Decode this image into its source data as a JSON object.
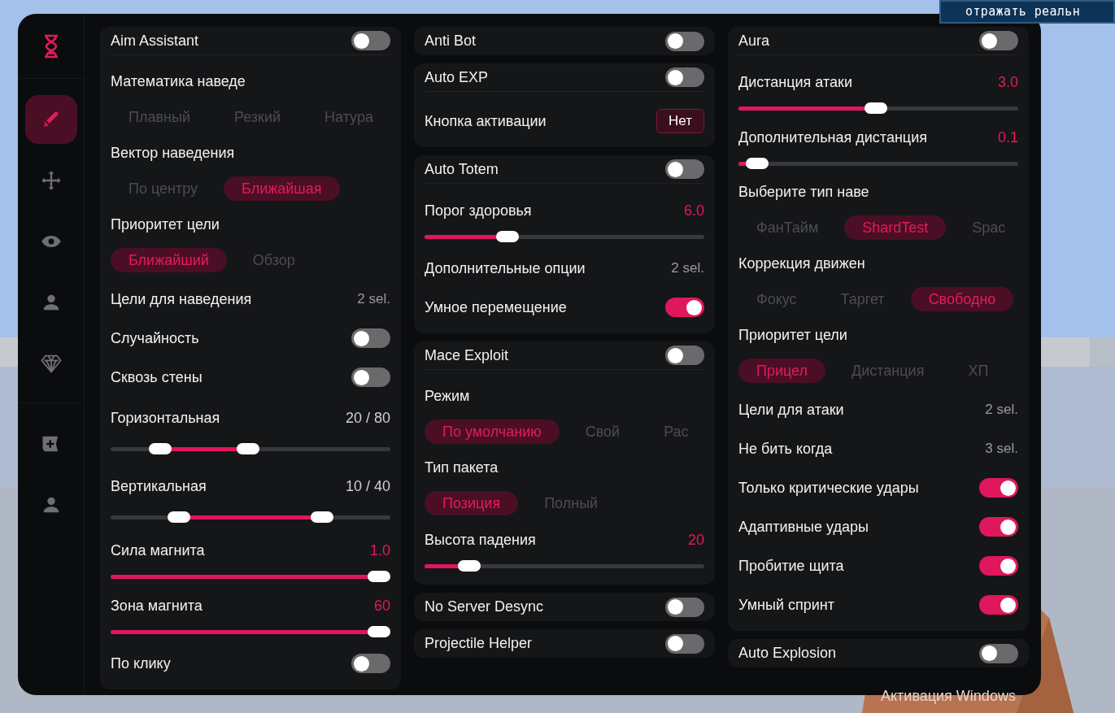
{
  "game_chat": {
    "text": "отражать реальн"
  },
  "os_notice": {
    "text": "Активация Windows"
  },
  "sidebar": {
    "sections": [
      {
        "items": [
          {
            "selected": true
          },
          {
            "selected": false
          },
          {
            "selected": false
          },
          {
            "selected": false
          },
          {
            "selected": false
          }
        ]
      },
      {
        "items": [
          {
            "selected": false
          },
          {
            "selected": false
          }
        ]
      }
    ]
  },
  "columns": [
    [
      {
        "name": "Aim Assistant",
        "enabled": false,
        "settings": [
          {
            "kind": "chips",
            "label": "Математика наведе",
            "options": [
              {
                "label": "Плавный",
                "selected": false
              },
              {
                "label": "Резкий",
                "selected": false
              },
              {
                "label": "Натура",
                "selected": false
              }
            ]
          },
          {
            "kind": "chips",
            "label": "Вектор наведения",
            "options": [
              {
                "label": "По центру",
                "selected": false
              },
              {
                "label": "Ближайшая",
                "selected": true
              }
            ]
          },
          {
            "kind": "chips",
            "label": "Приоритет цели",
            "options": [
              {
                "label": "Ближайший",
                "selected": true
              },
              {
                "label": "Обзор",
                "selected": false
              }
            ]
          },
          {
            "kind": "select",
            "label": "Цели для наведения",
            "value": "2 sel."
          },
          {
            "kind": "toggle",
            "label": "Случайность",
            "on": false
          },
          {
            "kind": "toggle",
            "label": "Сквозь стены",
            "on": false
          },
          {
            "kind": "range",
            "label": "Горизонтальная",
            "value": "20 / 80",
            "thumbs": [
              {
                "level": 0.15
              },
              {
                "level": 0.49
              }
            ]
          },
          {
            "kind": "range",
            "label": "Вертикальная",
            "value": "10 / 40",
            "thumbs": [
              {
                "level": 0.22
              },
              {
                "level": 0.78
              }
            ]
          },
          {
            "kind": "slider",
            "label": "Сила магнита",
            "value": "1.0",
            "level": 1
          },
          {
            "kind": "slider",
            "label": "Зона магнита",
            "value": "60",
            "level": 1
          },
          {
            "kind": "toggle",
            "label": "По клику",
            "on": false
          }
        ]
      }
    ],
    [
      {
        "name": "Anti Bot",
        "enabled": false
      },
      {
        "name": "Auto EXP",
        "enabled": false,
        "settings": [
          {
            "kind": "bind",
            "label": "Кнопка активации",
            "value": "Нет"
          }
        ]
      },
      {
        "name": "Auto Totem",
        "enabled": false,
        "settings": [
          {
            "kind": "slider",
            "label": "Порог здоровья",
            "value": "6.0",
            "level": 0.28
          },
          {
            "kind": "select",
            "label": "Дополнительные опции",
            "value": "2 sel."
          },
          {
            "kind": "toggle",
            "label": "Умное перемещение",
            "on": true
          }
        ]
      },
      {
        "name": "Mace Exploit",
        "enabled": false,
        "settings": [
          {
            "kind": "chips",
            "label": "Режим",
            "options": [
              {
                "label": "По умолчанию",
                "selected": true
              },
              {
                "label": "Свой",
                "selected": false
              },
              {
                "label": "Рас",
                "selected": false
              }
            ]
          },
          {
            "kind": "chips",
            "label": "Тип пакета",
            "options": [
              {
                "label": "Позиция",
                "selected": true
              },
              {
                "label": "Полный",
                "selected": false
              }
            ]
          },
          {
            "kind": "slider",
            "label": "Высота падения",
            "value": "20",
            "level": 0.13
          }
        ]
      },
      {
        "name": "No Server Desync",
        "enabled": false
      },
      {
        "name": "Projectile Helper",
        "enabled": false
      }
    ],
    [
      {
        "name": "Aura",
        "enabled": false,
        "settings": [
          {
            "kind": "slider",
            "label": "Дистанция атаки",
            "value": "3.0",
            "level": 0.49
          },
          {
            "kind": "slider",
            "label": "Дополнительная дистанция",
            "value": "0.1",
            "level": 0.03
          },
          {
            "kind": "chips",
            "label": "Выберите тип наве",
            "options": [
              {
                "label": "ФанТайм",
                "selected": false
              },
              {
                "label": "ShardTest",
                "selected": true
              },
              {
                "label": "Spac",
                "selected": false
              }
            ]
          },
          {
            "kind": "chips",
            "label": "Коррекция движен",
            "options": [
              {
                "label": "Фокус",
                "selected": false
              },
              {
                "label": "Таргет",
                "selected": false
              },
              {
                "label": "Свободно",
                "selected": true
              }
            ]
          },
          {
            "kind": "chips",
            "label": "Приоритет цели",
            "options": [
              {
                "label": "Прицел",
                "selected": true
              },
              {
                "label": "Дистанция",
                "selected": false
              },
              {
                "label": "ХП",
                "selected": false
              }
            ]
          },
          {
            "kind": "select",
            "label": "Цели для атаки",
            "value": "2 sel."
          },
          {
            "kind": "select",
            "label": "Не бить когда",
            "value": "3 sel."
          },
          {
            "kind": "toggle",
            "label": "Только критические удары",
            "on": true
          },
          {
            "kind": "toggle",
            "label": "Адаптивные удары",
            "on": true
          },
          {
            "kind": "toggle",
            "label": "Пробитие щита",
            "on": true
          },
          {
            "kind": "toggle",
            "label": "Умный спринт",
            "on": true
          }
        ]
      },
      {
        "name": "Auto Explosion",
        "enabled": false
      }
    ]
  ]
}
